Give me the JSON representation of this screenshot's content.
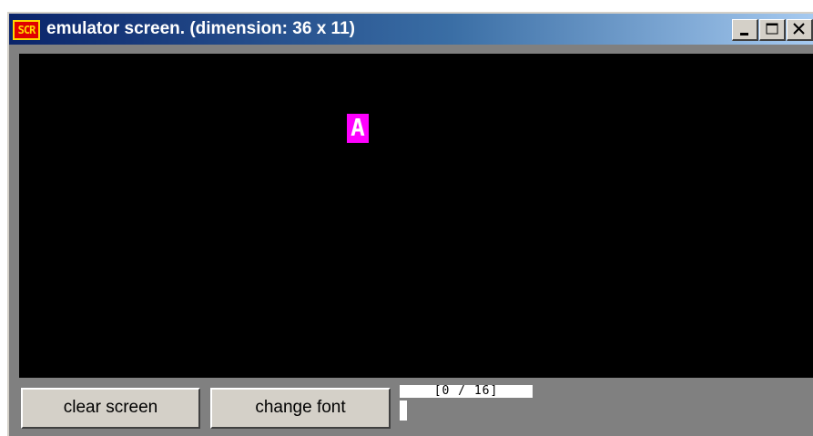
{
  "window": {
    "title": "emulator screen. (dimension: 36 x 11)",
    "icon_label": "SCR",
    "icon_name": "scr-app-icon",
    "controls": [
      {
        "name": "minimize-icon"
      },
      {
        "name": "maximize-icon"
      },
      {
        "name": "close-icon"
      }
    ]
  },
  "screen": {
    "background_color": "#000000",
    "cells": [
      {
        "char": "A",
        "bg_color": "#ff00ff",
        "fg_color": "#ffffff"
      }
    ]
  },
  "buttons": {
    "clear_screen": "clear screen",
    "change_font": "change font"
  },
  "status": {
    "counter": "[0 / 16]",
    "input_value": ""
  }
}
